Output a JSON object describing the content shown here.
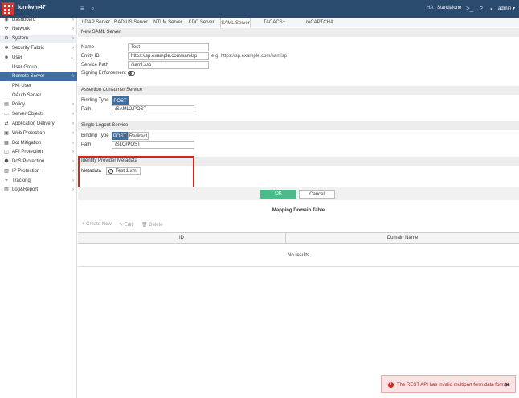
{
  "header": {
    "hostname": "lon-kvm47",
    "ha_label": "HA :",
    "ha_value": "Standalone",
    "user": "admin"
  },
  "sidebar": {
    "items": [
      {
        "label": "Dashboard",
        "icon": "dashboard-icon"
      },
      {
        "label": "Network",
        "icon": "network-icon"
      },
      {
        "label": "System",
        "icon": "gear-icon"
      },
      {
        "label": "Security Fabric",
        "icon": "fabric-icon"
      },
      {
        "label": "User",
        "icon": "user-icon"
      },
      {
        "label": "User Group"
      },
      {
        "label": "Remote Server"
      },
      {
        "label": "PKI User"
      },
      {
        "label": "OAuth Server"
      },
      {
        "label": "Policy",
        "icon": "policy-icon"
      },
      {
        "label": "Server Objects",
        "icon": "server-icon"
      },
      {
        "label": "Application Delivery",
        "icon": "delivery-icon"
      },
      {
        "label": "Web Protection",
        "icon": "lock-icon"
      },
      {
        "label": "Bot Mitigation",
        "icon": "bot-icon"
      },
      {
        "label": "API Protection",
        "icon": "api-icon"
      },
      {
        "label": "DoS Protection",
        "icon": "shield-icon"
      },
      {
        "label": "IP Protection",
        "icon": "ip-icon"
      },
      {
        "label": "Tracking",
        "icon": "tracking-icon"
      },
      {
        "label": "Log&Report",
        "icon": "report-icon"
      }
    ]
  },
  "tabs": [
    "LDAP Server",
    "RADIUS Server",
    "NTLM Server",
    "KDC Server",
    "SAML Server",
    "TACACS+ Server",
    "reCAPTCHA Server"
  ],
  "form": {
    "section_title": "New SAML Server",
    "name_label": "Name",
    "name_value": "Test",
    "entity_id_label": "Entity ID",
    "entity_id_value": "https://sp.example.com/samlsp",
    "entity_id_hint": "e.g. https://sp.example.com/samlsp",
    "service_path_label": "Service Path",
    "service_path_value": "/saml.sso",
    "signing_label": "Signing Enforcement",
    "acs_title": "Assertion Consumer Service",
    "acs_binding_label": "Binding Type",
    "acs_binding_value": "POST",
    "acs_path_label": "Path",
    "acs_path_value": "/SAML2/POST",
    "slo_title": "Single Logout Service",
    "slo_binding_label": "Binding Type",
    "slo_binding_post": "POST",
    "slo_binding_redirect": "Redirect",
    "slo_path_label": "Path",
    "slo_path_value": "/SLO/POST",
    "idp_title": "Identity Provider Metadata",
    "metadata_label": "Metadata",
    "metadata_file": "Test 1.xml",
    "ok_label": "OK",
    "cancel_label": "Cancel"
  },
  "mapping": {
    "title": "Mapping Domain Table",
    "create_label": "+ Create New",
    "edit_label": "✎ Edit",
    "delete_label": "🗑 Delete",
    "col_id": "ID",
    "col_domain": "Domain Name",
    "empty": "No results"
  },
  "toast": {
    "message": "The REST API has invalid multipart form data format."
  },
  "colors": {
    "topbar": "#2a4b6e",
    "accent": "#3f6ea0",
    "ok": "#4cbb8b",
    "highlight": "#d9231d"
  }
}
